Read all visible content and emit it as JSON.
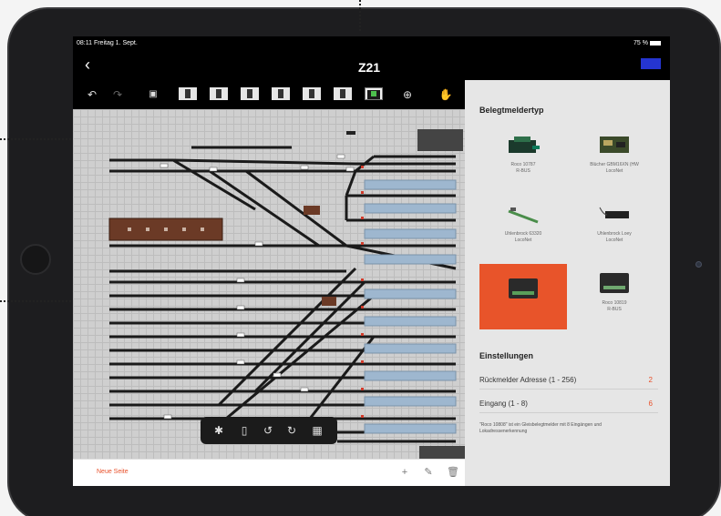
{
  "status_bar": {
    "time_date": "08:11  Freitag 1. Sept.",
    "battery": "75 %"
  },
  "nav": {
    "back_icon": "chevron-left-icon",
    "title": "Z21",
    "done_label": ""
  },
  "panel": {
    "heading": "Belegtmeldertyp",
    "items": [
      {
        "label": "Roco 10787\nR-BUS"
      },
      {
        "label": "Blücher GBM16XN (HW\nLocoNet"
      },
      {
        "label": "Uhlenbrock 63320\nLocoNet"
      },
      {
        "label": "Uhlenbrock Loey\nLocoNet"
      },
      {
        "label": ""
      },
      {
        "label": "Roco 10819\nR-BUS"
      }
    ],
    "settings_heading": "Einstellungen",
    "address_label": "Rückmelder Adresse (1 - 256)",
    "address_value": "2",
    "input_label": "Eingang (1 - 8)",
    "input_value": "6",
    "note": "\"Roco 10808\" ist ein Gleisbelegtmelder mit 8 Eingängen und Lokadressenerkennung"
  },
  "bottom": {
    "new_page": "Neue Seite"
  },
  "colors": {
    "accent": "#e8542a",
    "done": "#2535d0",
    "panel": "#e6e6e6"
  }
}
